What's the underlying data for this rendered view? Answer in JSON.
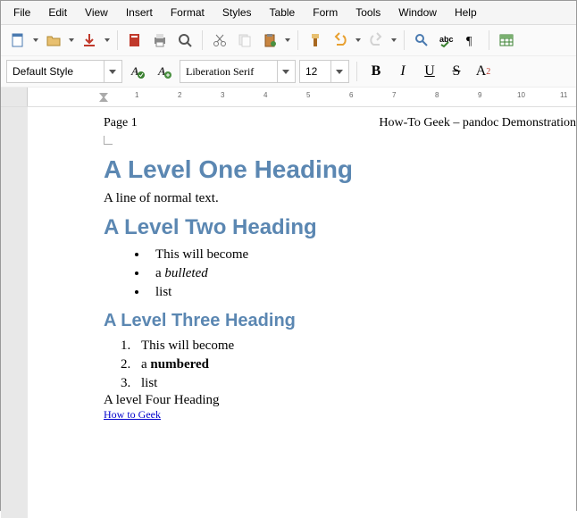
{
  "menu": {
    "items": [
      "File",
      "Edit",
      "View",
      "Insert",
      "Format",
      "Styles",
      "Table",
      "Form",
      "Tools",
      "Window",
      "Help"
    ]
  },
  "toolbar2": {
    "style": "Default Style",
    "font": "Liberation Serif",
    "size": "12",
    "bold": "B",
    "italic": "I",
    "underline": "U",
    "strike": "S",
    "super": "A",
    "super_exp": "2"
  },
  "ruler": {
    "ticks": [
      "1",
      "2",
      "3",
      "4",
      "5",
      "6",
      "7",
      "8",
      "9",
      "10",
      "11"
    ]
  },
  "doc": {
    "header_left": "Page 1",
    "header_right": "How-To Geek – pandoc Demonstration",
    "h1": "A Level One Heading",
    "p1": "A line of normal text.",
    "h2": "A Level Two Heading",
    "bullets": [
      {
        "pre": "This will become",
        "em": "",
        "post": ""
      },
      {
        "pre": "a ",
        "em": "bulleted",
        "post": ""
      },
      {
        "pre": "list",
        "em": "",
        "post": ""
      }
    ],
    "h3": "A Level Three Heading",
    "numbers": [
      {
        "pre": "This will become",
        "strong": "",
        "post": ""
      },
      {
        "pre": "a ",
        "strong": "numbered",
        "post": ""
      },
      {
        "pre": "list",
        "strong": "",
        "post": ""
      }
    ],
    "h4": "A level Four Heading",
    "link": "How to Geek"
  }
}
